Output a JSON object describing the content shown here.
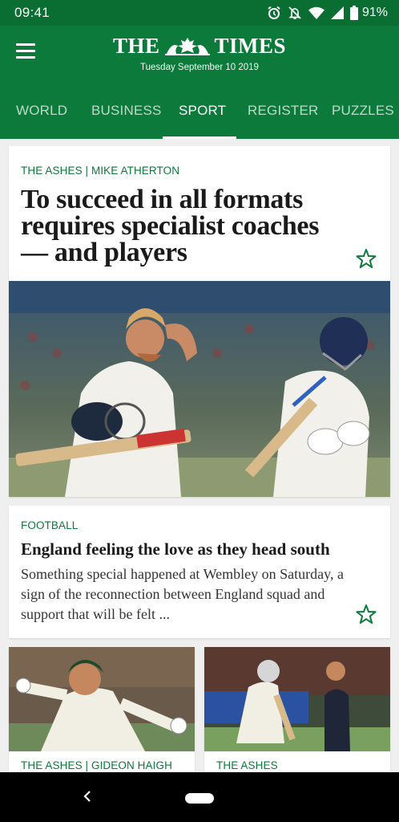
{
  "status_bar": {
    "time": "09:41",
    "battery": "91%",
    "icons": [
      "alarm-icon",
      "mute-icon",
      "wifi-icon",
      "signal-icon",
      "battery-icon"
    ]
  },
  "header": {
    "title_left": "THE",
    "title_right": "TIMES",
    "date": "Tuesday September 10 2019",
    "menu_icon": "hamburger-menu-icon",
    "background": "#0b7a3a"
  },
  "tabs": [
    {
      "label": "WORLD",
      "active": false
    },
    {
      "label": "BUSINESS",
      "active": false
    },
    {
      "label": "SPORT",
      "active": true
    },
    {
      "label": "REGISTER",
      "active": false
    },
    {
      "label": "PUZZLES",
      "active": false
    }
  ],
  "articles": {
    "lead": {
      "kicker": "THE ASHES | MIKE ATHERTON",
      "headline": "To succeed in all formats requires specialist coaches — and players",
      "image": "cricketers-walking-off-photo"
    },
    "second": {
      "kicker": "FOOTBALL",
      "headline": "England feeling the love as they head south",
      "standfirst": "Something special happened at Wembley on Saturday, a sign of the reconnection between England squad and support that will be felt ..."
    },
    "tile_left": {
      "kicker": "THE ASHES | GIDEON HAIGH",
      "image": "australian-bowler-celebrating-photo"
    },
    "tile_right": {
      "kicker": "THE ASHES",
      "image": "batsman-in-nets-photo"
    }
  },
  "colors": {
    "brand_green": "#0b7a3a",
    "status_green": "#0a6e33",
    "background": "#efefef"
  }
}
